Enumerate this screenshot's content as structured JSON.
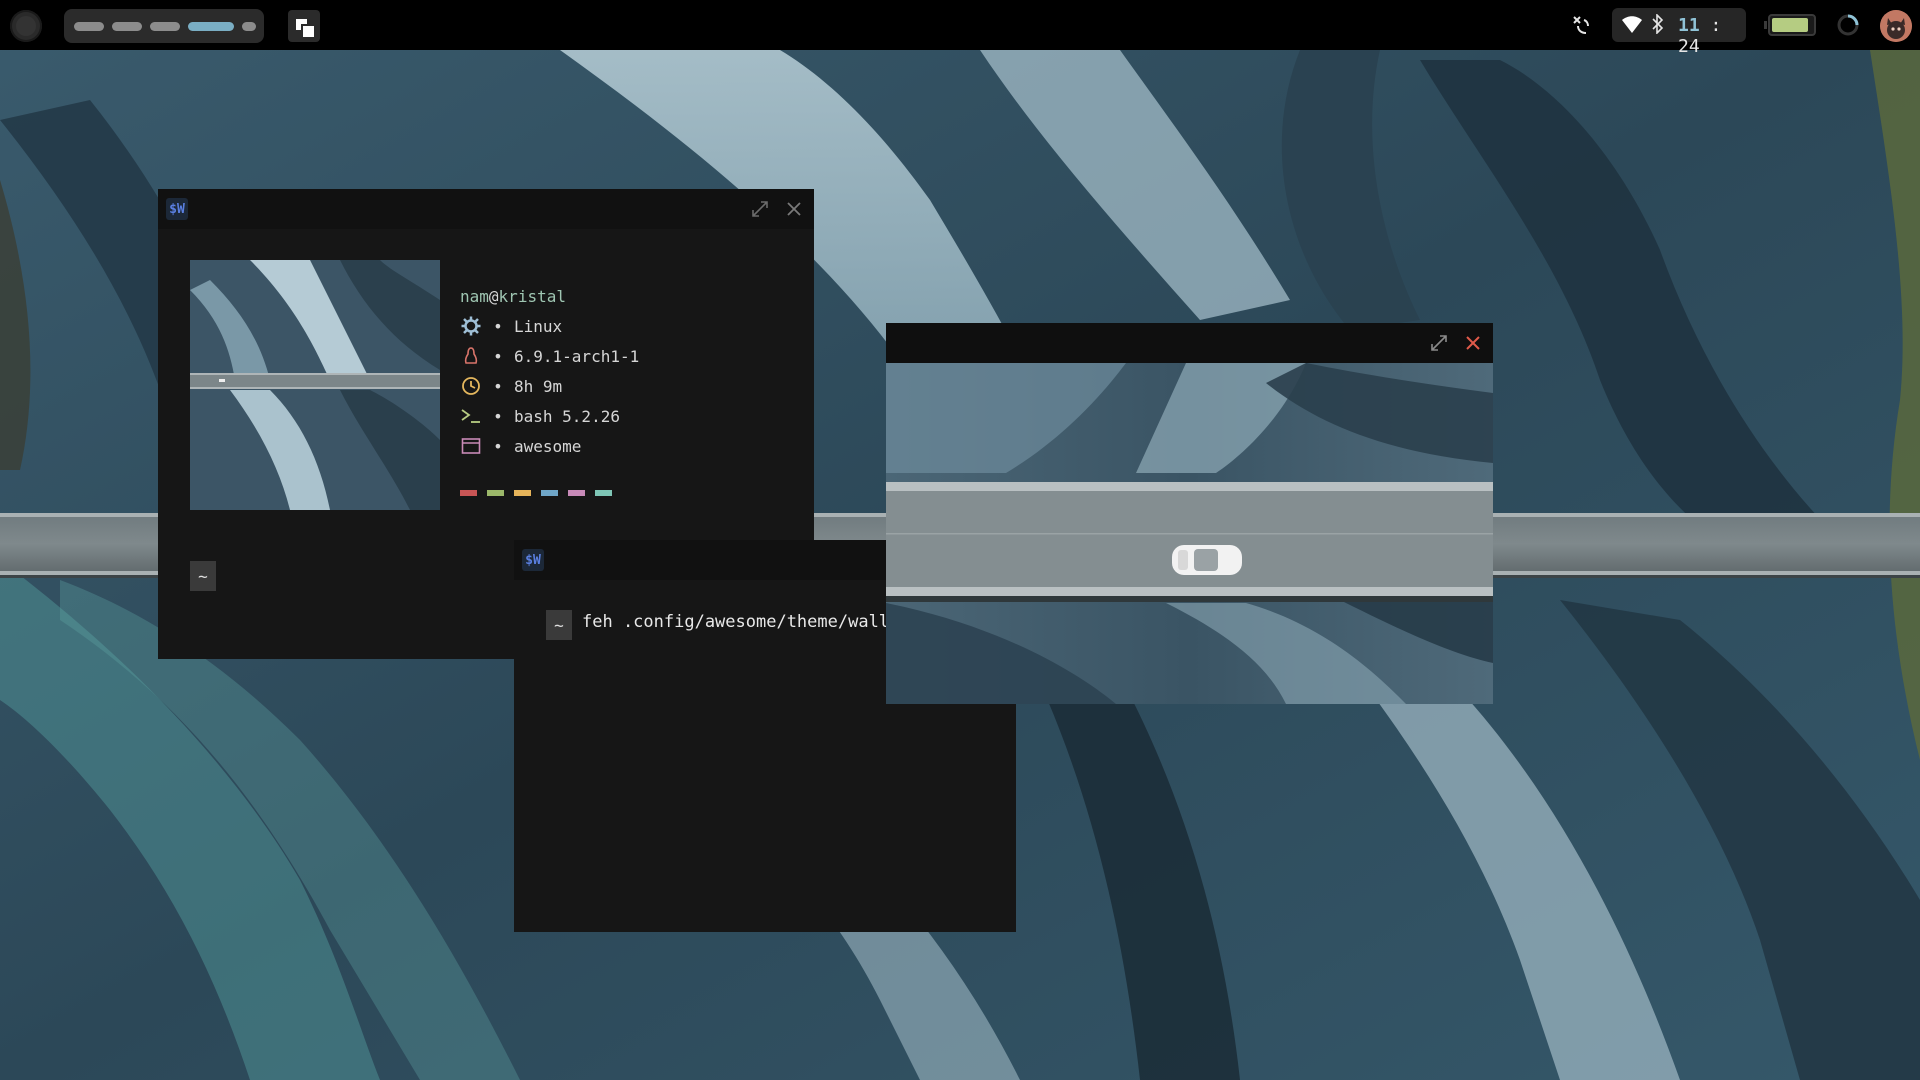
{
  "topbar": {
    "tags_count": 5,
    "clock_hour": "11",
    "clock_sep": " : ",
    "clock_minute": "24",
    "battery_level": 0.9,
    "icons": [
      "launcher-icon",
      "layout-icon",
      "network-manager-icon",
      "wifi-icon",
      "bluetooth-icon",
      "battery-icon",
      "loading-spinner-icon",
      "avatar-icon"
    ]
  },
  "fetch_window": {
    "title_icon": "$W",
    "user": "nam",
    "at": "@",
    "host": "kristal",
    "bullet": "•",
    "lines": [
      {
        "icon": "gear-icon",
        "value": "Linux"
      },
      {
        "icon": "penguin-icon",
        "value": "6.9.1-arch1-1"
      },
      {
        "icon": "clock-icon",
        "value": "8h 9m"
      },
      {
        "icon": "terminal-icon",
        "value": "bash 5.2.26"
      },
      {
        "icon": "window-icon",
        "value": "awesome"
      }
    ],
    "palette": [
      "#c85555",
      "#9cb86a",
      "#e6b45a",
      "#6fa6c8",
      "#c88ab8",
      "#7fc6b6"
    ],
    "prompt": "~"
  },
  "feh_window": {
    "title_icon": "$W",
    "prompt": "~",
    "command": "feh .config/awesome/theme/wall.jpg"
  },
  "colors": {
    "accent": "#8fc2d6",
    "window_bg": "#161616",
    "titlebar_bg": "#111111",
    "close": "#e05a4a"
  }
}
